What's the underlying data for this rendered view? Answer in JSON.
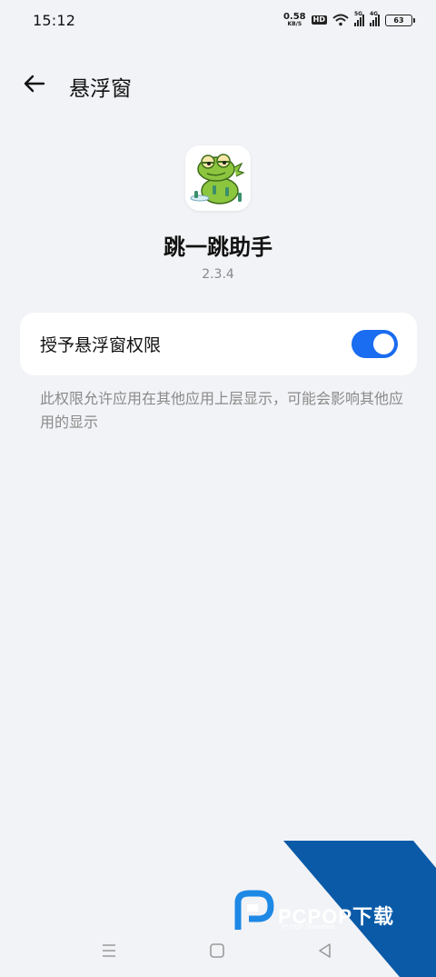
{
  "status_bar": {
    "time": "15:12",
    "net_speed_value": "0.58",
    "net_speed_unit": "KB/S",
    "hd_badge": "HD",
    "signal1_gen": "5G",
    "signal2_gen": "4G",
    "battery": "63"
  },
  "header": {
    "title": "悬浮窗"
  },
  "app": {
    "name": "跳一跳助手",
    "version": "2.3.4"
  },
  "permission": {
    "label": "授予悬浮窗权限",
    "enabled": true,
    "description": "此权限允许应用在其他应用上层显示，可能会影响其他应用的显示"
  },
  "watermark": {
    "brand": "PCPOP下载",
    "sub": "PCPOP Download"
  },
  "colors": {
    "accent": "#1a6cf0",
    "background": "#f2f3f6",
    "card": "#ffffff",
    "watermark_blue": "#0a5aa8"
  }
}
